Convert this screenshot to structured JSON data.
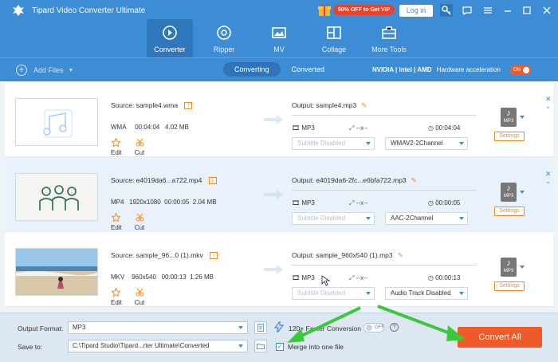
{
  "app": {
    "title": "Tipard Video Converter Ultimate",
    "promo": "50% OFF to Get VIP",
    "login": "Log in"
  },
  "nav": [
    {
      "label": "Converter",
      "icon": "converter-icon",
      "active": true
    },
    {
      "label": "Ripper",
      "icon": "ripper-icon"
    },
    {
      "label": "MV",
      "icon": "mv-icon"
    },
    {
      "label": "Collage",
      "icon": "collage-icon"
    },
    {
      "label": "More Tools",
      "icon": "toolbox-icon"
    }
  ],
  "toolbar": {
    "add_files": "Add Files",
    "tabs": [
      "Converting",
      "Converted"
    ],
    "hw_vendors": "NVIDIA | Intel | AMD",
    "hw_label": "Hardware acceleration",
    "hw_toggle": "ON"
  },
  "files": [
    {
      "source": "Source: sample4.wma",
      "format": "WMA",
      "resolution": "",
      "duration": "00:04:04",
      "size": "4.02 MB",
      "output": "Output: sample4.mp3",
      "out_format": "MP3",
      "out_res": "--x--",
      "out_duration": "00:04:04",
      "subtitle": "Subtitle Disabled",
      "audio": "WMAV2-2Channel"
    },
    {
      "source": "Source: e4019da6...a722.mp4",
      "format": "MP4",
      "resolution": "1920x1080",
      "duration": "00:00:05",
      "size": "2.04 MB",
      "output": "Output: e4019da6-2fc...e6bfa722.mp3",
      "out_format": "MP3",
      "out_res": "--x--",
      "out_duration": "00:00:05",
      "subtitle": "Subtitle Disabled",
      "audio": "AAC-2Channel"
    },
    {
      "source": "Source: sample_96...0 (1).mkv",
      "format": "MKV",
      "resolution": "960x540",
      "duration": "00:00:13",
      "size": "1.26 MB",
      "output": "Output: sample_960x540 (1).mp3",
      "out_format": "MP3",
      "out_res": "--x--",
      "out_duration": "00:00:13",
      "subtitle": "Subtitle Disabled",
      "audio": "Audio Track Disabled"
    }
  ],
  "row_actions": {
    "edit": "Edit",
    "cut": "Cut",
    "settings": "Settings",
    "format_badge": "MP3"
  },
  "bottom": {
    "output_format_label": "Output Format:",
    "output_format_value": "MP3",
    "save_to_label": "Save to:",
    "save_to_value": "C:\\Tipard Studio\\Tipard...rter Ultimate\\Converted",
    "faster_label": "120× Faster Conversion",
    "faster_toggle": "OFF",
    "merge_label": "Merge into one file",
    "convert_all": "Convert All"
  },
  "colors": {
    "brand": "#3d8dd6",
    "accent": "#f05a28",
    "annotation": "#3cc83c"
  }
}
